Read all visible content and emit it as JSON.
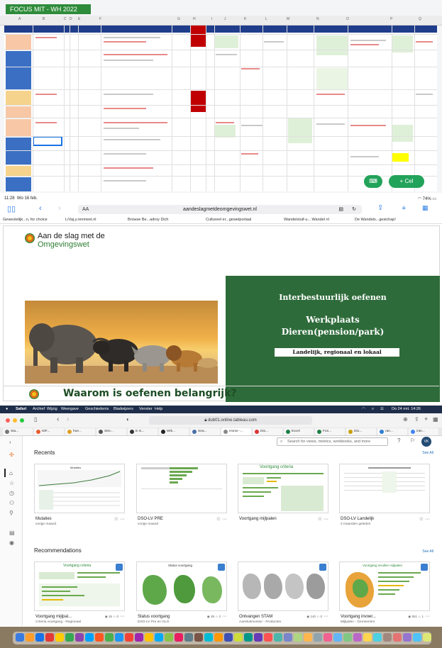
{
  "spreadsheet": {
    "title": "FOCUS MIT - WH 2022",
    "columns": [
      "A",
      "B",
      "C",
      "D",
      "E",
      "F",
      "G",
      "H",
      "I",
      "J",
      "K",
      "L",
      "M",
      "N",
      "O",
      "P",
      "Q"
    ],
    "fab_keyboard_label": "⌨",
    "fab_cell_label": "+ Cel",
    "colors": {
      "header_band": "#1f3d8a",
      "blue_block": "#3a6fc4",
      "orange_block": "#f7c7a6",
      "yellow_block": "#f6d38c",
      "red_block": "#c00000",
      "green_cell": "#dff0d8",
      "fab": "#22a35a"
    }
  },
  "ipad": {
    "status_time": "11:28",
    "status_date": "Wo 16 feb.",
    "status_battery": "74%",
    "url": "aandeslagmetdeomgevingswet.nl",
    "text_size_label": "AA",
    "favorites": [
      "Gewestelijk...n, for choice",
      "L/Vaj.y.renmeet.nl",
      "Browse Be...adroy Dich",
      "Cultureel er...gewetportaal",
      "Wandelstuif-u... Wandel nl",
      "De Wandels...gesichap!"
    ],
    "slide": {
      "logo_line1": "Aan de slag met de",
      "logo_line2": "Omgevingswet",
      "box_title": "Interbestuurlijk oefenen",
      "box_subtitle1": "Werkplaats",
      "box_subtitle2": "Dieren(pension/park)",
      "box_tag": "Landelijk, regionaal en lokaal",
      "footer_title": "Waarom is oefenen belangrijk?"
    }
  },
  "mac": {
    "menubar": {
      "apple": "",
      "app": "Safari",
      "menus": [
        "Archief",
        "Wijzig",
        "Weergave",
        "Geschiedenis",
        "Bladwijzers",
        "Venster",
        "Help"
      ],
      "clock": "Do 24 mrt. 14:26"
    },
    "url": "dub01.online.tableau.com",
    "tabs": [
      "Sta...",
      "IDF...",
      "hoe...",
      "Stre...",
      "E ni...",
      "Wik...",
      "Sea...",
      "Home -...",
      "Dio...",
      "Excel",
      "Fon...",
      "Dio...",
      "ran...",
      "inte..."
    ],
    "search_placeholder": "Search for views, metrics, workbooks, and more",
    "avatar_initials": "VK",
    "recents_title": "Recents",
    "recommendations_title": "Recommendations",
    "see_all": "See All",
    "recents": [
      {
        "title": "Mutaties",
        "subtitle": "vorige maand"
      },
      {
        "title": "DSO-LV PRE",
        "subtitle": "vorige maand"
      },
      {
        "title": "Voortgang mijlpalen",
        "subtitle": ""
      },
      {
        "title": "DSO-LV Landelijk",
        "subtitle": "2 maanden geleden"
      }
    ],
    "recommendations": [
      {
        "title": "Voortgang mijlpal...",
        "subtitle": "Criteria voortgang - Regionaal",
        "views": "16",
        "favorites": "0"
      },
      {
        "title": "Status voortgang",
        "subtitle": "DSO-LV Pre en GLO",
        "views": "38",
        "favorites": "2"
      },
      {
        "title": "Ontvangen STAM",
        "subtitle": "Aansluitmonitor - Producten",
        "views": "140",
        "favorites": "0"
      },
      {
        "title": "Voortgang invoer...",
        "subtitle": "Mijlpalen - Gemeenten",
        "views": "551",
        "favorites": "1"
      }
    ],
    "thumb_labels": {
      "mutaties": "Mutaties",
      "voortgang_criteria": "Voortgang criteria",
      "status_voortgang": "Status voortgang",
      "voortgang_invullen": "Voortgang invullen mijlpalen"
    }
  }
}
